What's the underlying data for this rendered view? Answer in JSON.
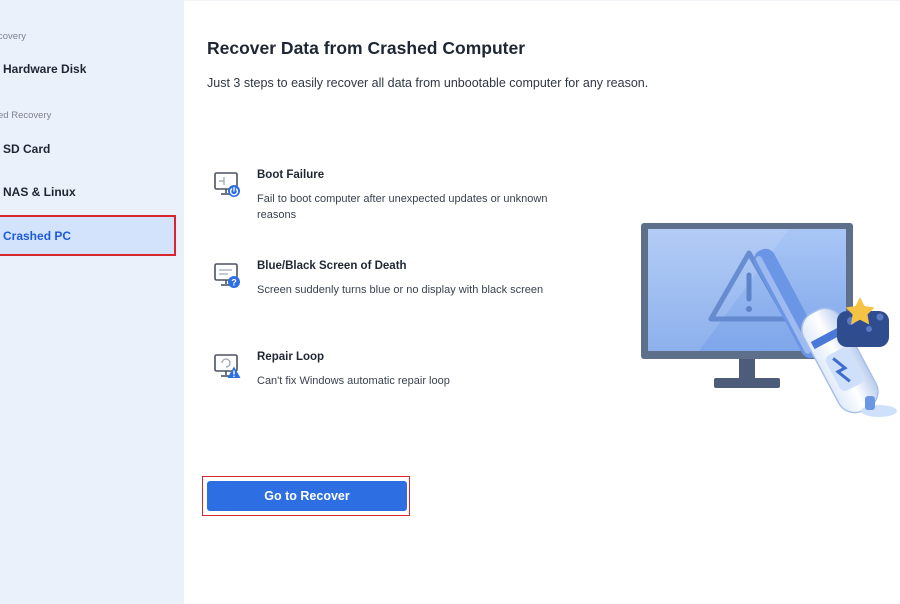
{
  "sidebar": {
    "section1_label": "covery",
    "hardware_disk": "Hardware Disk",
    "section2_label": "ed Recovery",
    "sd_card": "SD Card",
    "nas_linux": "NAS & Linux",
    "crashed_pc": "Crashed PC"
  },
  "main": {
    "title": "Recover Data from Crashed Computer",
    "subtitle": "Just 3 steps to easily recover all data from unbootable computer for any reason.",
    "reasons": [
      {
        "title": "Boot Failure",
        "desc": "Fail to boot computer after unexpected updates or unknown reasons",
        "icon": "monitor-power-icon"
      },
      {
        "title": "Blue/Black Screen of Death",
        "desc": "Screen suddenly turns blue or no display with black screen",
        "icon": "monitor-question-icon"
      },
      {
        "title": "Repair Loop",
        "desc": "Can't fix Windows automatic repair loop",
        "icon": "monitor-warning-icon"
      }
    ],
    "recover_button": "Go to Recover"
  },
  "colors": {
    "accent": "#2d6fe3",
    "active_text": "#1d5cd6",
    "highlight_border": "#d9262c",
    "sidebar_bg": "#eaf1fb"
  }
}
